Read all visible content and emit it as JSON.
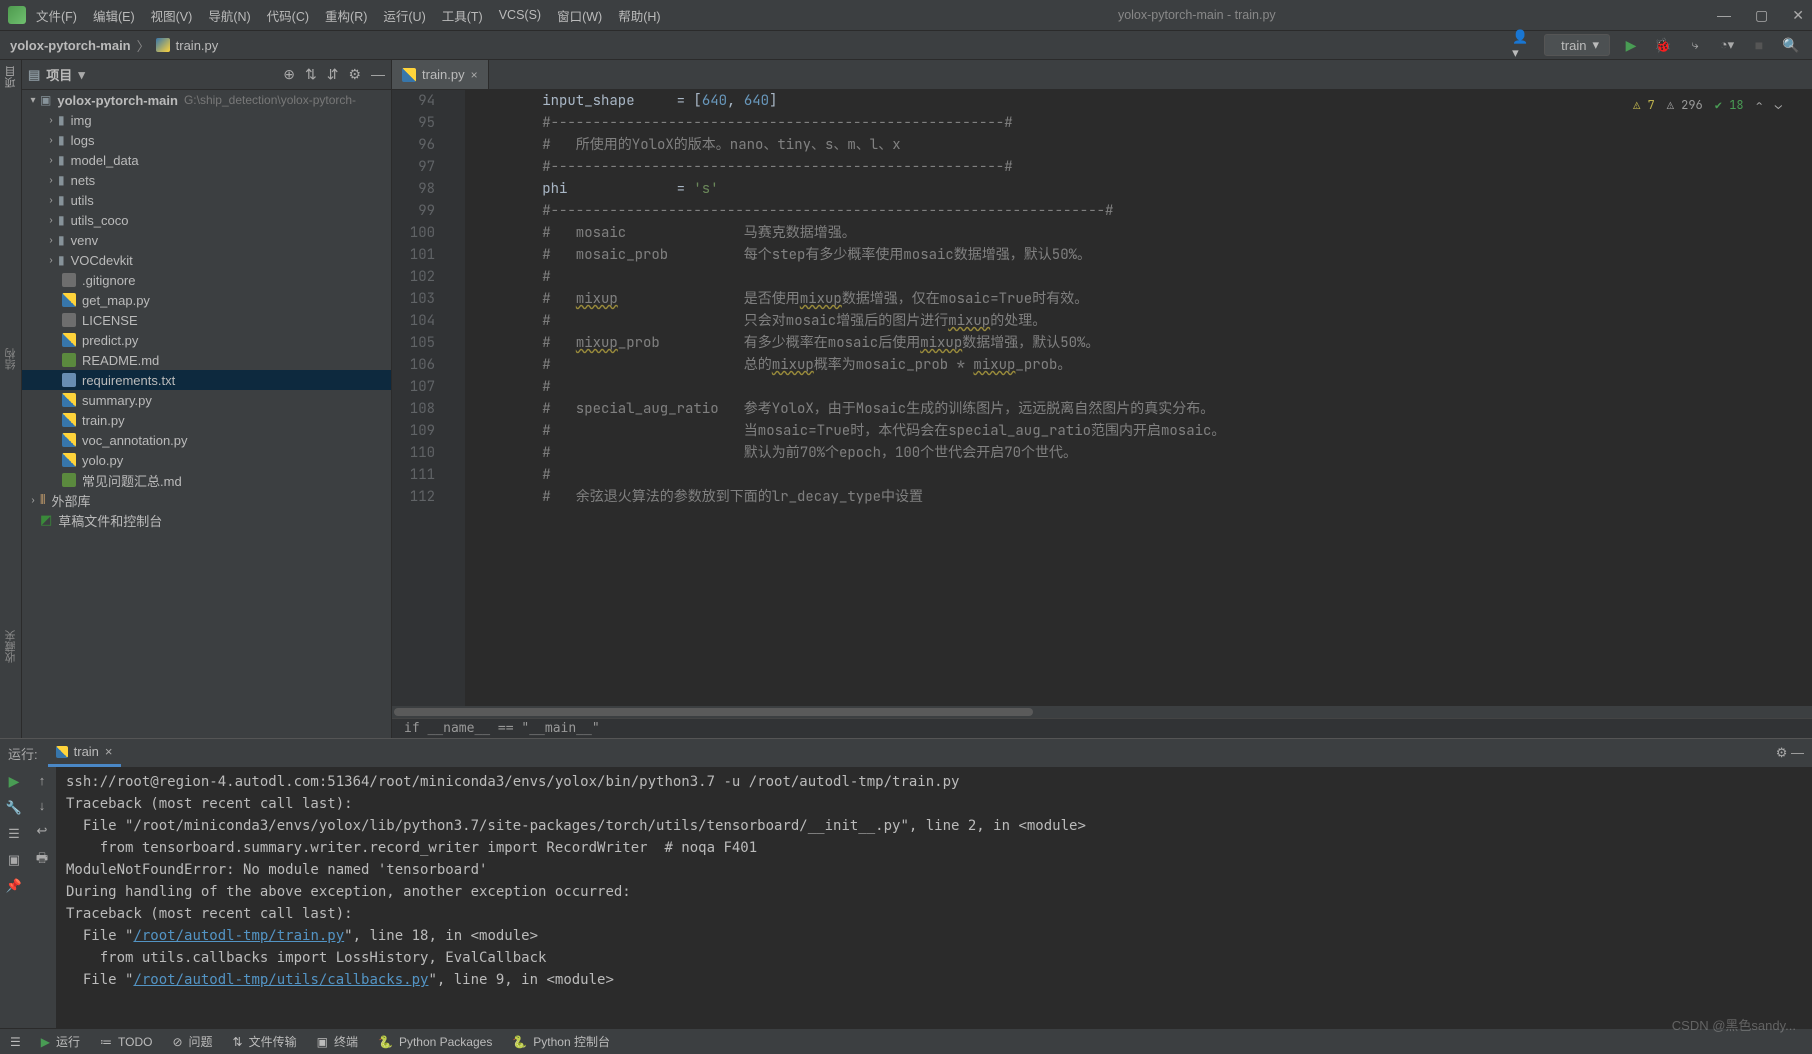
{
  "menubar": {
    "items": [
      "文件(F)",
      "编辑(E)",
      "视图(V)",
      "导航(N)",
      "代码(C)",
      "重构(R)",
      "运行(U)",
      "工具(T)",
      "VCS(S)",
      "窗口(W)",
      "帮助(H)"
    ],
    "title": "yolox-pytorch-main - train.py"
  },
  "breadcrumb": {
    "root": "yolox-pytorch-main",
    "file": "train.py"
  },
  "run_config": {
    "name": "train"
  },
  "project_panel": {
    "title": "项目",
    "root": {
      "name": "yolox-pytorch-main",
      "path": "G:\\ship_detection\\yolox-pytorch-"
    },
    "folders": [
      "img",
      "logs",
      "model_data",
      "nets",
      "utils",
      "utils_coco",
      "venv",
      "VOCdevkit"
    ],
    "files": [
      {
        "name": ".gitignore",
        "type": "generic"
      },
      {
        "name": "get_map.py",
        "type": "py"
      },
      {
        "name": "LICENSE",
        "type": "generic"
      },
      {
        "name": "predict.py",
        "type": "py"
      },
      {
        "name": "README.md",
        "type": "md"
      },
      {
        "name": "requirements.txt",
        "type": "txt",
        "selected": true
      },
      {
        "name": "summary.py",
        "type": "py"
      },
      {
        "name": "train.py",
        "type": "py"
      },
      {
        "name": "voc_annotation.py",
        "type": "py"
      },
      {
        "name": "yolo.py",
        "type": "py"
      },
      {
        "name": "常见问题汇总.md",
        "type": "md"
      }
    ],
    "extra": [
      {
        "name": "外部库",
        "icon": "lib"
      },
      {
        "name": "草稿文件和控制台",
        "icon": "scratch"
      }
    ]
  },
  "editor": {
    "tab": "train.py",
    "line_start": 94,
    "line_end": 112,
    "status": {
      "warn1": "7",
      "warn2": "296",
      "ok": "18"
    },
    "breadcrumb_bottom": "if __name__ == \"__main__\"",
    "lines": [
      {
        "html": "        input_shape     = [<span class=\"c-num\">640</span>, <span class=\"c-num\">640</span>]"
      },
      {
        "html": "        <span class=\"c-comment\">#------------------------------------------------------#</span>"
      },
      {
        "html": "        <span class=\"c-comment\">#   所使用的YoloX的版本。nano、tiny、s、m、l、x</span>"
      },
      {
        "html": "        <span class=\"c-comment\">#------------------------------------------------------#</span>"
      },
      {
        "html": "        phi             = <span class=\"c-str\">'s'</span>"
      },
      {
        "html": "        <span class=\"c-comment\">#------------------------------------------------------------------#</span>"
      },
      {
        "html": "        <span class=\"c-comment\">#   mosaic              马赛克数据增强。</span>"
      },
      {
        "html": "        <span class=\"c-comment\">#   mosaic_prob         每个step有多少概率使用mosaic数据增强，默认50%。</span>"
      },
      {
        "html": "        <span class=\"c-comment\">#</span>"
      },
      {
        "html": "        <span class=\"c-comment\">#   <span class=\"c-warn\">mixup</span>               是否使用<span class=\"c-warn\">mixup</span>数据增强，仅在mosaic=True时有效。</span>"
      },
      {
        "html": "        <span class=\"c-comment\">#                       只会对mosaic增强后的图片进行<span class=\"c-warn\">mixup</span>的处理。</span>"
      },
      {
        "html": "        <span class=\"c-comment\">#   <span class=\"c-warn\">mixup</span>_prob          有多少概率在mosaic后使用<span class=\"c-warn\">mixup</span>数据增强，默认50%。</span>"
      },
      {
        "html": "        <span class=\"c-comment\">#                       总的<span class=\"c-warn\">mixup</span>概率为mosaic_prob * <span class=\"c-warn\">mixup</span>_prob。</span>"
      },
      {
        "html": "        <span class=\"c-comment\">#</span>"
      },
      {
        "html": "        <span class=\"c-comment\">#   special_aug_ratio   参考YoloX，由于Mosaic生成的训练图片，远远脱离自然图片的真实分布。</span>"
      },
      {
        "html": "        <span class=\"c-comment\">#                       当mosaic=True时，本代码会在special_aug_ratio范围内开启mosaic。</span>"
      },
      {
        "html": "        <span class=\"c-comment\">#                       默认为前70%个epoch，100个世代会开启70个世代。</span>"
      },
      {
        "html": "        <span class=\"c-comment\">#</span>"
      },
      {
        "html": "        <span class=\"c-comment\">#   余弦退火算法的参数放到下面的lr_decay_type中设置</span>"
      }
    ]
  },
  "run_panel": {
    "title": "运行:",
    "tab": "train",
    "lines": [
      {
        "text": "ssh://root@region-4.autodl.com:51364/root/miniconda3/envs/yolox/bin/python3.7 -u /root/autodl-tmp/train.py"
      },
      {
        "text": "Traceback (most recent call last):"
      },
      {
        "text": "  File \"/root/miniconda3/envs/yolox/lib/python3.7/site-packages/torch/utils/tensorboard/__init__.py\", line 2, in <module>"
      },
      {
        "text": "    from tensorboard.summary.writer.record_writer import RecordWriter  # noqa F401"
      },
      {
        "text": "ModuleNotFoundError: No module named 'tensorboard'"
      },
      {
        "text": ""
      },
      {
        "text": "During handling of the above exception, another exception occurred:"
      },
      {
        "text": ""
      },
      {
        "text": "Traceback (most recent call last):"
      },
      {
        "html": "  File \"<span class=\"link\">/root/autodl-tmp/train.py</span>\", line 18, in &lt;module&gt;"
      },
      {
        "text": "    from utils.callbacks import LossHistory, EvalCallback"
      },
      {
        "html": "  File \"<span class=\"link\">/root/autodl-tmp/utils/callbacks.py</span>\", line 9, in &lt;module&gt;"
      }
    ]
  },
  "statusbar": {
    "items": [
      "运行",
      "TODO",
      "问题",
      "文件传输",
      "终端",
      "Python Packages",
      "Python 控制台"
    ]
  },
  "left_tool": {
    "proj": "项目",
    "struct": "结构",
    "fav": "收藏夹"
  },
  "watermark": "CSDN @黑色sandy..."
}
